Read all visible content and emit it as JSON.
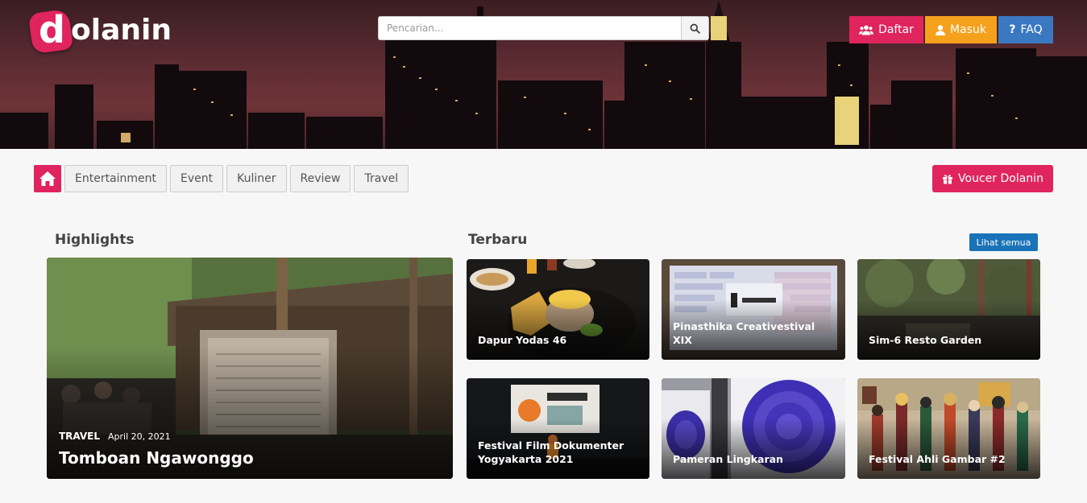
{
  "brand": {
    "letter": "d",
    "rest": "olanin"
  },
  "search": {
    "placeholder": "Pencarian..."
  },
  "header_buttons": {
    "daftar": "Daftar",
    "masuk": "Masuk",
    "faq": "FAQ"
  },
  "nav": {
    "items": [
      "Entertainment",
      "Event",
      "Kuliner",
      "Review",
      "Travel"
    ],
    "voucher": "Voucer Dolanin"
  },
  "highlights": {
    "title": "Highlights",
    "card": {
      "category": "TRAVEL",
      "date": "April 20, 2021",
      "title": "Tomboan Ngawonggo"
    }
  },
  "terbaru": {
    "title": "Terbaru",
    "see_all": "Lihat semua",
    "cards": [
      {
        "title": "Dapur Yodas 46"
      },
      {
        "title": "Pinasthika Creativestival XIX"
      },
      {
        "title": "Sim-6 Resto Garden"
      },
      {
        "title": "Festival Film Dokumenter Yogyakarta 2021"
      },
      {
        "title": "Pameran Lingkaran"
      },
      {
        "title": "Festival Ahli Gambar #2"
      }
    ]
  },
  "colors": {
    "primary": "#e0245e",
    "orange": "#f5a11c",
    "blue": "#3b78c2",
    "see_all": "#1a73b8"
  }
}
